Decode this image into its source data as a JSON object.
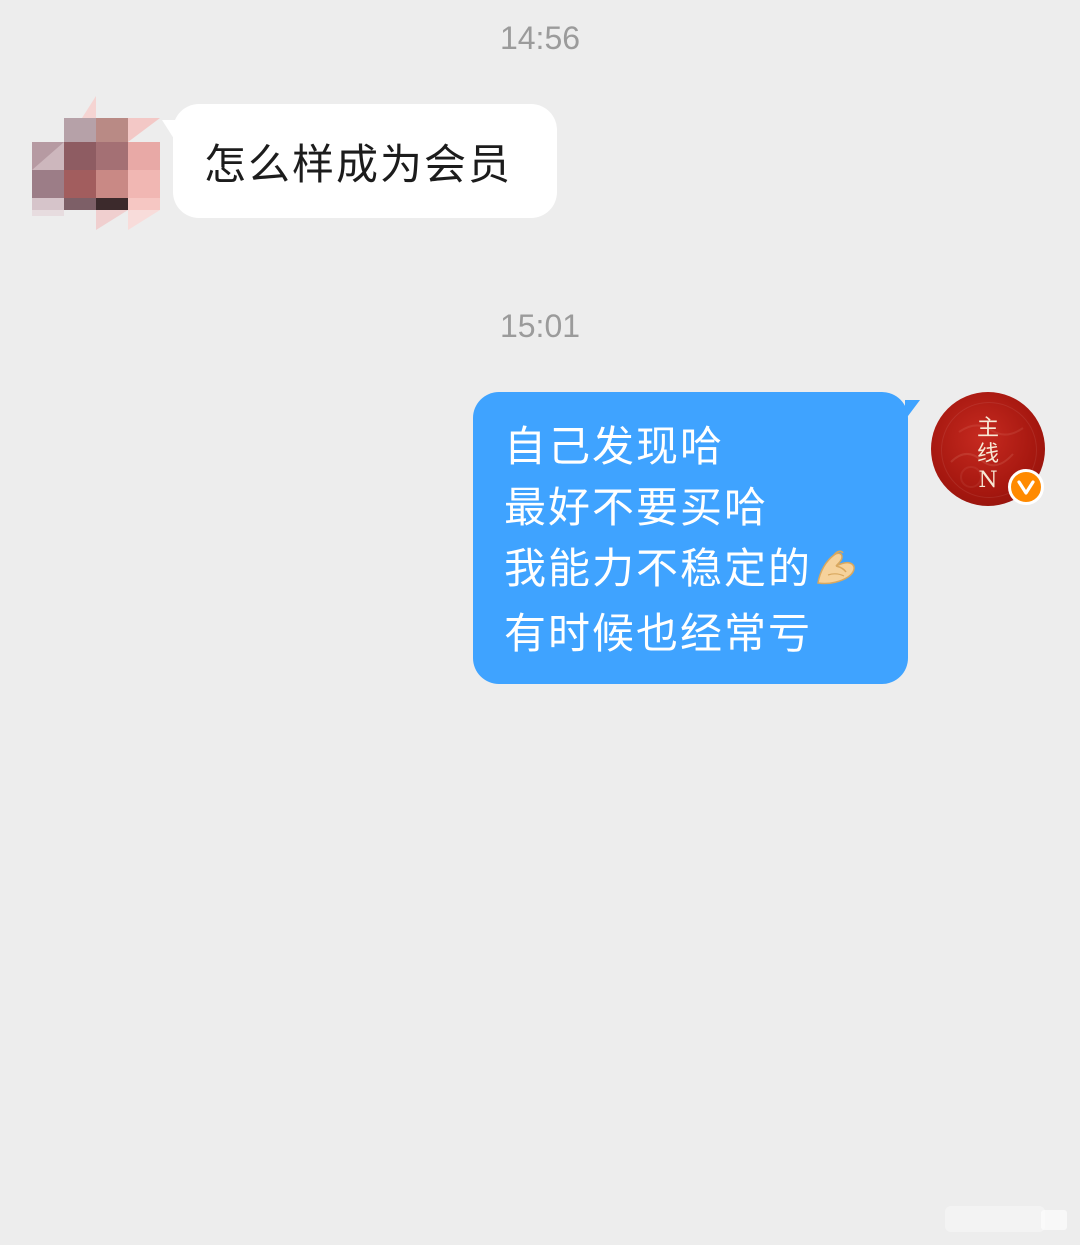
{
  "timestamps": [
    "14:56",
    "15:01"
  ],
  "messages": [
    {
      "direction": "incoming",
      "text": "怎么样成为会员"
    },
    {
      "direction": "outgoing",
      "lines": [
        "自己发现哈",
        "最好不要买哈",
        "我能力不稳定的",
        "有时候也经常亏"
      ],
      "emoji_after_line": 2,
      "emoji": "🤌"
    }
  ],
  "avatar_outgoing": {
    "text_lines": [
      "主",
      "线",
      "N"
    ],
    "badge": "verified-v-badge",
    "badge_color": "#ff8a00",
    "color": "#a5170f"
  },
  "colors": {
    "background": "#ededed",
    "incoming_bubble": "#ffffff",
    "outgoing_bubble": "#3fa3ff",
    "timestamp": "#9b9b9b"
  }
}
